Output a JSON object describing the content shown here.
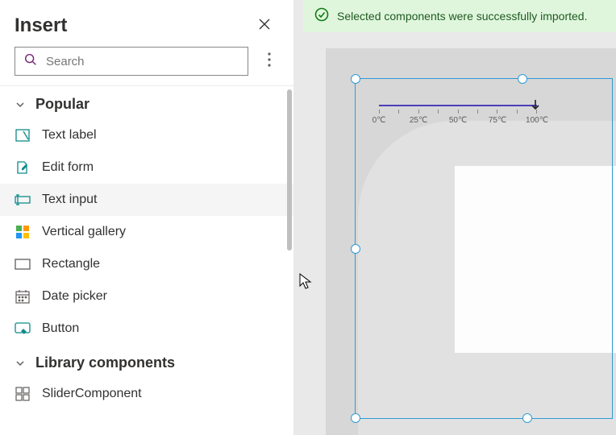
{
  "sidebar": {
    "title": "Insert",
    "search_placeholder": "Search",
    "groups": [
      {
        "id": "popular",
        "label": "Popular",
        "items": [
          {
            "id": "text-label",
            "label": "Text label"
          },
          {
            "id": "edit-form",
            "label": "Edit form"
          },
          {
            "id": "text-input",
            "label": "Text input"
          },
          {
            "id": "vertical-gallery",
            "label": "Vertical gallery"
          },
          {
            "id": "rectangle",
            "label": "Rectangle"
          },
          {
            "id": "date-picker",
            "label": "Date picker"
          },
          {
            "id": "button",
            "label": "Button"
          }
        ]
      },
      {
        "id": "library",
        "label": "Library components",
        "items": [
          {
            "id": "slider-component",
            "label": "SliderComponent"
          }
        ]
      }
    ]
  },
  "banner": {
    "text": "Selected components were successfully imported."
  },
  "slider": {
    "ticks": [
      "0℃",
      "25℃",
      "50℃",
      "75℃",
      "100℃"
    ]
  },
  "colors": {
    "accent": "#742774",
    "success": "#107c10",
    "selection": "#2f9bd6",
    "slider": "#4b3db8"
  }
}
